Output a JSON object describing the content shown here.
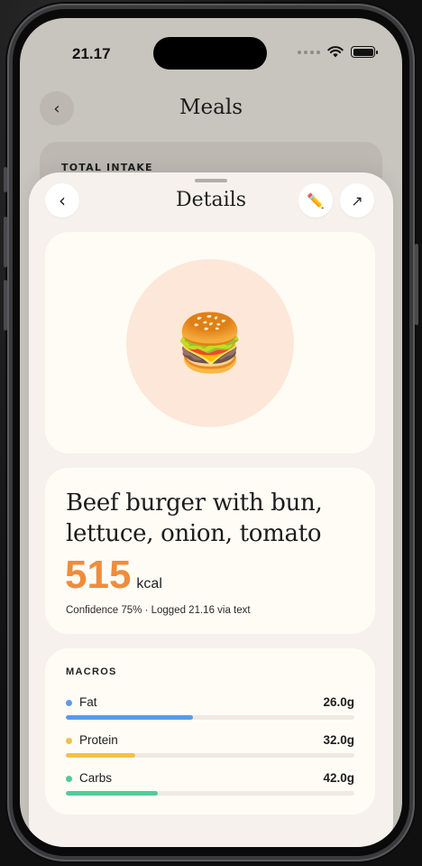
{
  "status_bar": {
    "time": "21.17"
  },
  "background_page": {
    "back_icon": "chevron-left-icon",
    "back_glyph": "‹",
    "title": "Meals",
    "summary_label": "TOTAL INTAKE"
  },
  "sheet": {
    "title": "Details",
    "back_glyph": "‹",
    "edit_icon": "pencil-icon",
    "edit_glyph": "✏️",
    "expand_icon": "arrow-up-right-icon",
    "expand_glyph": "↗",
    "food_emoji": "🍔",
    "food": {
      "name": "Beef burger with bun, lettuce, onion, tomato",
      "kcal": "515",
      "kcal_unit": "kcal",
      "meta": "Confidence 75% · Logged 21.16 via text"
    },
    "macros": {
      "label": "MACROS",
      "items": [
        {
          "name": "Fat",
          "value": "26.0g",
          "fraction": 0.44,
          "color": "#5b9be6"
        },
        {
          "name": "Protein",
          "value": "32.0g",
          "fraction": 0.24,
          "color": "#f2c04a"
        },
        {
          "name": "Carbs",
          "value": "42.0g",
          "fraction": 0.32,
          "color": "#4fcd96"
        }
      ]
    }
  },
  "colors": {
    "accent": "#f08c3a",
    "sheet_bg": "#f6f1ec",
    "card_bg": "#fffcf6"
  }
}
